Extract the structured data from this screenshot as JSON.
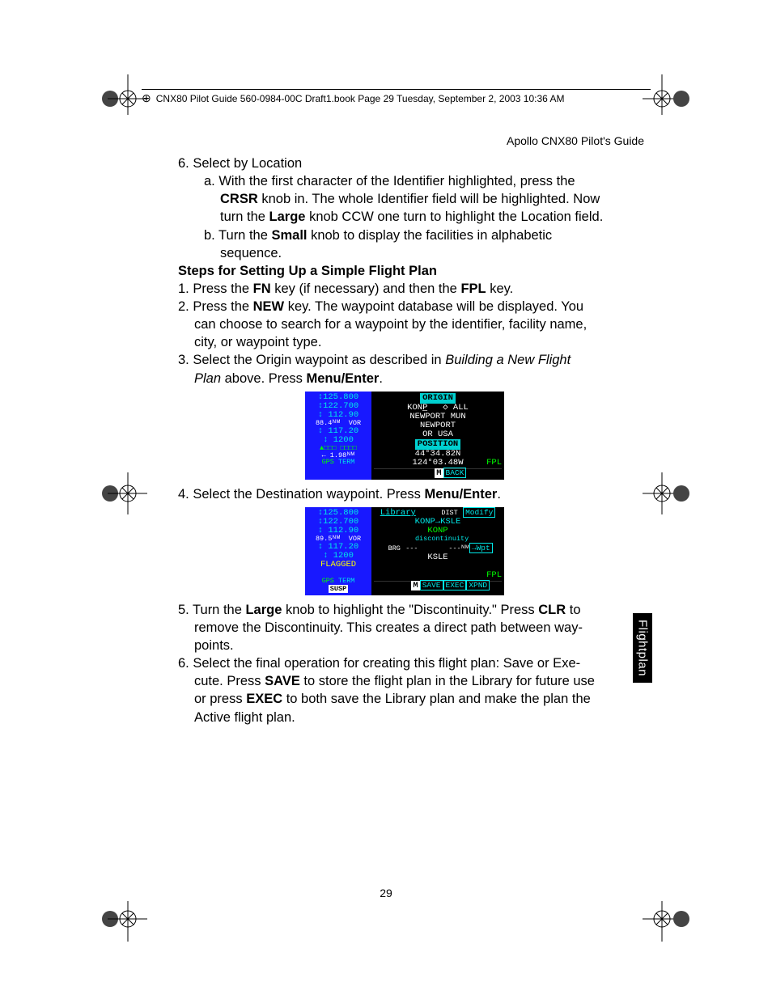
{
  "meta": {
    "book_header": "CNX80 Pilot Guide 560-0984-00C Draft1.book  Page 29  Tuesday, September 2, 2003  10:36 AM",
    "running_head": "Apollo CNX80 Pilot's Guide",
    "page_number": "29",
    "side_tab": "Flightplan"
  },
  "body": {
    "sel_loc_head": "6. Select by Location",
    "sel_loc_a1": "a. With the first character of the Identifier highlighted, press the",
    "sel_loc_a2_pre": "",
    "sel_loc_a2_bold1": "CRSR",
    "sel_loc_a2_mid": " knob in. The whole Identifier field will be highlighted. Now",
    "sel_loc_a3_pre": "turn the ",
    "sel_loc_a3_bold": "Large",
    "sel_loc_a3_post": " knob CCW one turn to highlight the Location field.",
    "sel_loc_b1_pre": "b. Turn the ",
    "sel_loc_b1_bold": "Small",
    "sel_loc_b1_post": " knob to display the facilities in alphabetic",
    "sel_loc_b2": "sequence.",
    "steps_head": "Steps for Setting Up a Simple Flight Plan",
    "s1_pre": "1. Press the ",
    "s1_b1": "FN",
    "s1_mid": " key (if necessary) and then the ",
    "s1_b2": "FPL",
    "s1_post": " key.",
    "s2_pre": "2. Press the ",
    "s2_b1": "NEW",
    "s2_mid": " key. The waypoint database will be displayed. You",
    "s2_l2": "can choose to search for a waypoint by the identifier, facility name,",
    "s2_l3": "city, or waypoint type.",
    "s3_l1": "3. Select the Origin waypoint as described in ",
    "s3_ital": "Building a New Flight",
    "s3_l2_ital": "Plan",
    "s3_l2_mid": " above. Press ",
    "s3_l2_bold": "Menu/Enter",
    "s3_l2_post": ".",
    "s4_pre": "4. Select the Destination waypoint. Press ",
    "s4_bold": "Menu/Enter",
    "s4_post": ".",
    "s5_pre": "5. Turn the ",
    "s5_bold1": "Large",
    "s5_mid1": " knob to highlight the \"Discontinuity.\" Press ",
    "s5_bold2": "CLR",
    "s5_mid2": " to",
    "s5_l2": "remove the Discontinuity. This creates a direct path between way-",
    "s5_l3": "points.",
    "s6_l1": "6. Select the final operation for creating this flight plan: Save or Exe-",
    "s6_l2_pre": "cute. Press ",
    "s6_l2_b1": "SAVE",
    "s6_l2_mid": " to store the flight plan in the Library for future use",
    "s6_l3_pre": "or press ",
    "s6_l3_b1": "EXEC",
    "s6_l3_post": " to both save the Library plan and make the plan the",
    "s6_l4": "Active flight plan."
  },
  "screen1": {
    "left": {
      "l1": "↕125.800",
      "l2": "↕122.700",
      "l3": "↕ 112.90",
      "l4a": "88.4ᴺᴹ",
      "l4b": "VOR",
      "l5": "↕ 117.20",
      "l6": "↕ 1200",
      "l7": "▲□□□ □□□□",
      "l8": "← 1.98ᴺᴹ",
      "l9a": "GPS",
      "l9b": "TERM"
    },
    "right": {
      "hdr": "ORIGIN",
      "r1a": "KONP̲",
      "r1b": "◇ ALL",
      "r2": "NEWPORT MUN",
      "r3": "NEWPORT",
      "r4": "OR USA",
      "pos_hdr": "POSITION",
      "r5": " 44°34.82N",
      "r6": "124°03.48W",
      "fpl": "FPL",
      "btm_m": "M",
      "btm_back": "BACK"
    }
  },
  "screen2": {
    "left": {
      "l1": "↕125.800",
      "l2": "↕122.700",
      "l3": "↕ 112.90",
      "l4a": "89.5ᴺᴹ",
      "l4b": "VOR",
      "l5": "↕ 117.20",
      "l6": "↕ 1200",
      "l7": "FLAGGED",
      "l9a": "GPS",
      "l9b": "TERM",
      "susp": "SUSP"
    },
    "right": {
      "hdr": "Library",
      "dist": "DIST",
      "modify": "Modify",
      "r1": "KONP→KSLE",
      "r2": "KONP",
      "r3": "discontinuity",
      "brg_lbl": "BRG",
      "brg_val": "---",
      "dash": "---ᴺᴹ",
      "wpt": "→Wpt",
      "r4": "KSLE",
      "fpl": "FPL",
      "btm_m": "M",
      "btm_save": "SAVE",
      "btm_exec": "EXEC",
      "btm_xpnd": "XPND"
    }
  }
}
